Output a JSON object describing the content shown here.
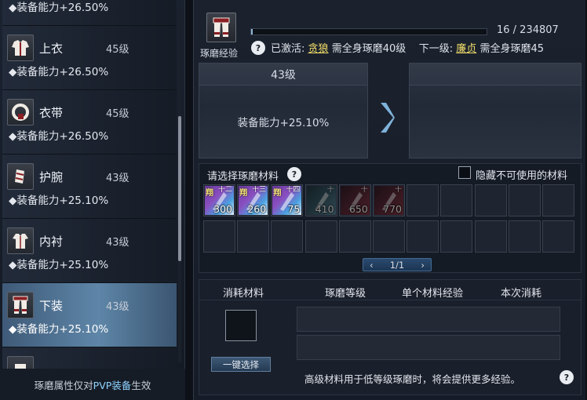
{
  "equipment_list": [
    {
      "name": "",
      "level": "",
      "bonus": "◆装备能力+26.50%",
      "icon": "shirt-icon"
    },
    {
      "name": "上衣",
      "level": "45级",
      "bonus": "◆装备能力+26.50%",
      "icon": "jacket-icon"
    },
    {
      "name": "衣带",
      "level": "45级",
      "bonus": "◆装备能力+26.50%",
      "icon": "belt-icon"
    },
    {
      "name": "护腕",
      "level": "43级",
      "bonus": "◆装备能力+25.10%",
      "icon": "bracer-icon"
    },
    {
      "name": "内衬",
      "level": "43级",
      "bonus": "◆装备能力+25.10%",
      "icon": "undershirt-icon"
    },
    {
      "name": "下装",
      "level": "43级",
      "bonus": "◆装备能力+25.10%",
      "icon": "pants-icon",
      "selected": true
    },
    {
      "name": "",
      "level": "",
      "bonus": "",
      "icon": "equipment-icon"
    }
  ],
  "footer": {
    "prefix": "琢磨属性仅对",
    "highlight": "PVP装备",
    "suffix": "生效"
  },
  "header": {
    "icon_label": "琢磨经验",
    "exp_current": 16,
    "exp_total": 234807,
    "exp_text": "16 / 234807",
    "activated_label": "已激活:",
    "activated_title": "贪狼",
    "activated_req": "需全身琢磨40级",
    "next_label": "下一级:",
    "next_title": "廉贞",
    "next_req": "需全身琢磨45"
  },
  "current_card": {
    "level": "43级",
    "stat": "装备能力+25.10%"
  },
  "next_card": {
    "level": "",
    "stat": ""
  },
  "materials": {
    "title": "请选择琢磨材料",
    "hide_label": "隐藏不可使用的材料",
    "hide_checked": false,
    "page": "1/1",
    "items": [
      {
        "count": "300",
        "tag": "翔",
        "tier": "十二",
        "type": "blue",
        "usable": true
      },
      {
        "count": "260",
        "tag": "翔",
        "tier": "十三",
        "type": "blue",
        "usable": true
      },
      {
        "count": "75",
        "tag": "翔",
        "tier": "十四",
        "type": "blue",
        "usable": true
      },
      {
        "count": "410",
        "tag": "",
        "tier": "十",
        "type": "teal",
        "usable": false
      },
      {
        "count": "650",
        "tag": "",
        "tier": "十",
        "type": "red",
        "usable": false
      },
      {
        "count": "770",
        "tag": "",
        "tier": "十",
        "type": "red",
        "usable": false
      }
    ]
  },
  "consume": {
    "col1": "消耗材料",
    "col2": "琢磨等级",
    "col3": "单个材料经验",
    "col4": "本次消耗",
    "button": "一键选择",
    "hint": "高级材料用于低等级琢磨时，将会提供更多经验。"
  },
  "colors": {
    "accent": "#8fd3ff",
    "title_gold": "#f3df6a",
    "selected_row": "#5e86a8"
  }
}
